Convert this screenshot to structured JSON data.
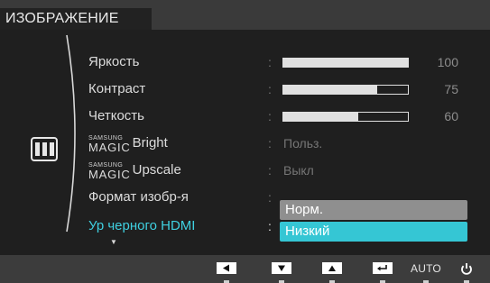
{
  "menu": {
    "title": "ИЗОБРАЖЕНИЕ"
  },
  "items": [
    {
      "label": "Яркость",
      "value": 100,
      "level": 1.0
    },
    {
      "label": "Контраст",
      "value": 75,
      "level": 0.75
    },
    {
      "label": "Четкость",
      "value": 60,
      "level": 0.6
    },
    {
      "brand_small": "SAMSUNG",
      "brand_big": "MAGIC",
      "word": "Bright",
      "value": "Польз."
    },
    {
      "brand_small": "SAMSUNG",
      "brand_big": "MAGIC",
      "word": "Upscale",
      "value": "Выкл"
    },
    {
      "label": "Формат изобр-я"
    },
    {
      "label": "Ур черного HDMI",
      "selected": true
    }
  ],
  "separator": ":",
  "dropdown": {
    "options": [
      "Норм.",
      "Низкий"
    ],
    "highlighted": "Низкий"
  },
  "bottom_bar": {
    "auto_label": "AUTO"
  },
  "colors": {
    "accent": "#35c6d4",
    "selected_text": "#3fd0e0",
    "panel": "#1f1f1f"
  },
  "icons": [
    "picture-icon",
    "left-arrow-icon",
    "down-arrow-icon",
    "up-arrow-icon",
    "enter-icon",
    "power-icon",
    "scroll-down-icon"
  ]
}
